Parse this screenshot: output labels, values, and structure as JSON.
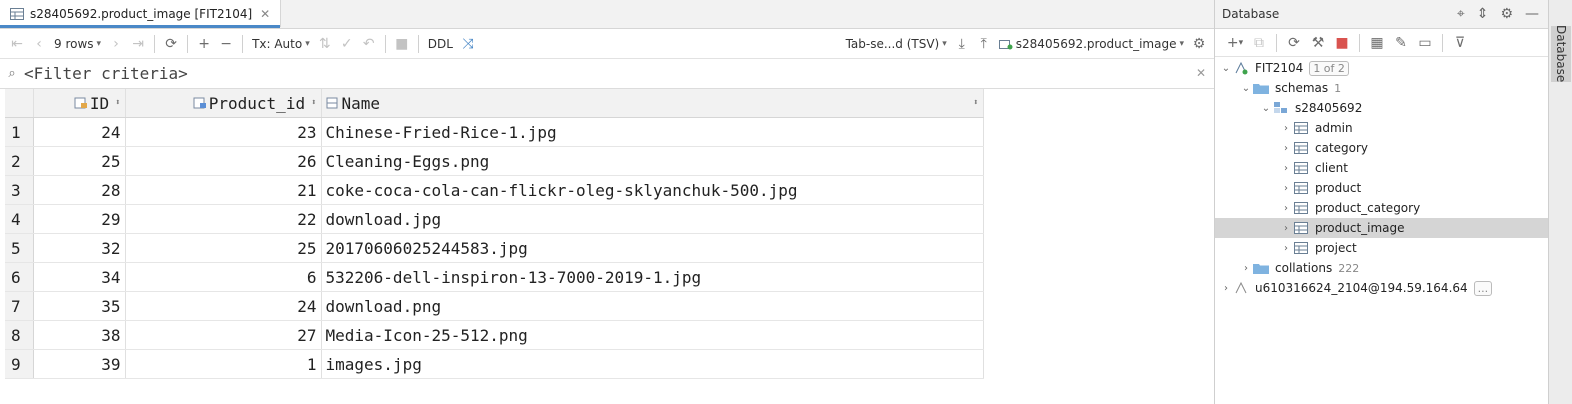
{
  "editor": {
    "tab_title": "s28405692.product_image [FIT2104]",
    "toolbar": {
      "rows_label": "9 rows",
      "tx_label": "Tx: Auto",
      "ddl_label": "DDL",
      "export_format": "Tab-se...d (TSV)",
      "target_table": "s28405692.product_image"
    },
    "filter": {
      "placeholder": "<Filter criteria>"
    },
    "grid": {
      "columns": [
        "ID",
        "Product_id",
        "Name"
      ],
      "rows": [
        {
          "n": "1",
          "id": "24",
          "product_id": "23",
          "name": "Chinese-Fried-Rice-1.jpg"
        },
        {
          "n": "2",
          "id": "25",
          "product_id": "26",
          "name": "Cleaning-Eggs.png"
        },
        {
          "n": "3",
          "id": "28",
          "product_id": "21",
          "name": "coke-coca-cola-can-flickr-oleg-sklyanchuk-500.jpg"
        },
        {
          "n": "4",
          "id": "29",
          "product_id": "22",
          "name": "download.jpg"
        },
        {
          "n": "5",
          "id": "32",
          "product_id": "25",
          "name": "20170606025244583.jpg"
        },
        {
          "n": "6",
          "id": "34",
          "product_id": "6",
          "name": "532206-dell-inspiron-13-7000-2019-1.jpg"
        },
        {
          "n": "7",
          "id": "35",
          "product_id": "24",
          "name": "download.png"
        },
        {
          "n": "8",
          "id": "38",
          "product_id": "27",
          "name": "Media-Icon-25-512.png"
        },
        {
          "n": "9",
          "id": "39",
          "product_id": "1",
          "name": "images.jpg"
        }
      ]
    }
  },
  "database_panel": {
    "title": "Database",
    "side_tab_label": "Database",
    "tree": {
      "root": {
        "label": "FIT2104",
        "badge": "1 of 2"
      },
      "schemas": {
        "label": "schemas",
        "count": "1"
      },
      "schema": {
        "label": "s28405692"
      },
      "tables": [
        {
          "label": "admin"
        },
        {
          "label": "category"
        },
        {
          "label": "client"
        },
        {
          "label": "product"
        },
        {
          "label": "product_category"
        },
        {
          "label": "product_image",
          "selected": true
        },
        {
          "label": "project"
        }
      ],
      "collations": {
        "label": "collations",
        "count": "222"
      },
      "other_connection": {
        "label": "u610316624_2104@194.59.164.64",
        "badge": "..."
      }
    }
  },
  "colors": {
    "accent_blue": "#4a88c7",
    "stop_red": "#d9534f",
    "folder_blue": "#7fb3e0",
    "selection_gray": "#d5d5d5"
  }
}
